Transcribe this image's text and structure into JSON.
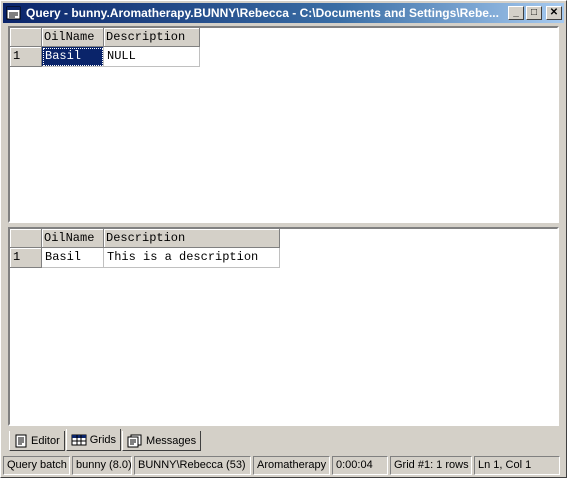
{
  "window": {
    "title": "Query - bunny.Aromatherapy.BUNNY\\Rebecca - C:\\Documents and Settings\\Rebe...",
    "controls": {
      "minimize": "_",
      "maximize": "□",
      "close": "✕"
    }
  },
  "result_grids": [
    {
      "columns": [
        "OilName",
        "Description"
      ],
      "rows": [
        {
          "num": "1",
          "cells": [
            "Basil",
            "NULL"
          ]
        }
      ]
    },
    {
      "columns": [
        "OilName",
        "Description"
      ],
      "rows": [
        {
          "num": "1",
          "cells": [
            "Basil",
            "This is a description"
          ]
        }
      ]
    }
  ],
  "tabs": [
    {
      "label": "Editor",
      "icon": "editor-icon",
      "active": false
    },
    {
      "label": "Grids",
      "icon": "grid-icon",
      "active": true
    },
    {
      "label": "Messages",
      "icon": "messages-icon",
      "active": false
    }
  ],
  "status": {
    "batch": "Query batch completed.",
    "server": "bunny (8.0)",
    "user": "BUNNY\\Rebecca (53)",
    "database": "Aromatherapy",
    "elapsed": "0:00:04",
    "grid_rows": "Grid #1: 1 rows",
    "position": "Ln 1, Col 1"
  },
  "colors": {
    "title_start": "#0a246a",
    "title_end": "#a6caf0",
    "selection": "#0a246a",
    "face": "#d4d0c8"
  }
}
